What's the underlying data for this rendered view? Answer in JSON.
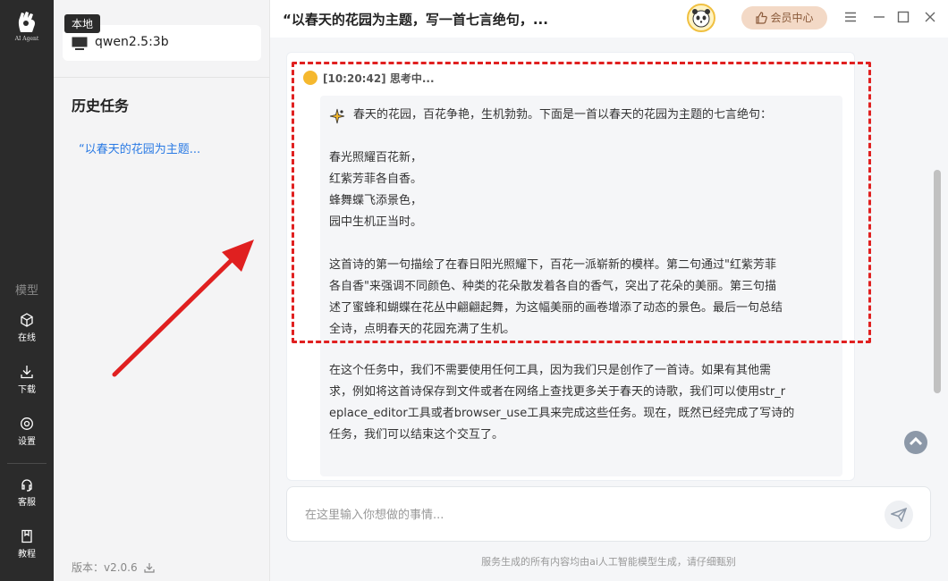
{
  "rail": {
    "logo_text": "AI Agent",
    "section_title": "模型",
    "items": [
      {
        "label": "在线",
        "icon": "cube-icon"
      },
      {
        "label": "下载",
        "icon": "download-icon"
      },
      {
        "label": "设置",
        "icon": "gear-icon"
      },
      {
        "label": "客服",
        "icon": "headset-icon"
      },
      {
        "label": "教程",
        "icon": "book-icon"
      }
    ]
  },
  "sidebar": {
    "local_tag": "本地",
    "model_name": "qwen2.5:3b",
    "history_title": "历史任务",
    "history_items": [
      "“以春天的花园为主题..."
    ],
    "version": "版本：v2.0.6"
  },
  "header": {
    "title": "“以春天的花园为主题，写一首七言绝句，...",
    "member_label": "会员中心"
  },
  "chat": {
    "status": "[10:20:42] 思考中...",
    "intro": "春天的花园，百花争艳，生机勃勃。下面是一首以春天的花园为主题的七言绝句：",
    "poem": [
      "春光照耀百花新，",
      "红紫芳菲各自香。",
      "蜂舞蝶飞添景色，",
      "园中生机正当时。"
    ],
    "explanation_lines": [
      "这首诗的第一句描绘了在春日阳光照耀下，百花一派崭新的模样。第二句通过\"红紫芳菲",
      "各自香\"来强调不同颜色、种类的花朵散发着各自的香气，突出了花朵的美丽。第三句描",
      "述了蜜蜂和蝴蝶在花丛中翩翩起舞，为这幅美丽的画卷增添了动态的景色。最后一句总结",
      "全诗，点明春天的花园充满了生机。"
    ],
    "followup_lines": [
      "在这个任务中，我们不需要使用任何工具，因为我们只是创作了一首诗。如果有其他需",
      "求，例如将这首诗保存到文件或者在网络上查找更多关于春天的诗歌，我们可以使用str_r",
      "eplace_editor工具或者browser_use工具来完成这些任务。现在，既然已经完成了写诗的",
      "任务，我们可以结束这个交互了。"
    ]
  },
  "input": {
    "placeholder": "在这里输入你想做的事情..."
  },
  "footer_note": "服务生成的所有内容均由ai人工智能模型生成，请仔细甄别",
  "colors": {
    "rail_bg": "#2b2b2b",
    "link_blue": "#2a7ae4",
    "annotation_red": "#e02020",
    "member_bg": "#f3d9c6"
  }
}
